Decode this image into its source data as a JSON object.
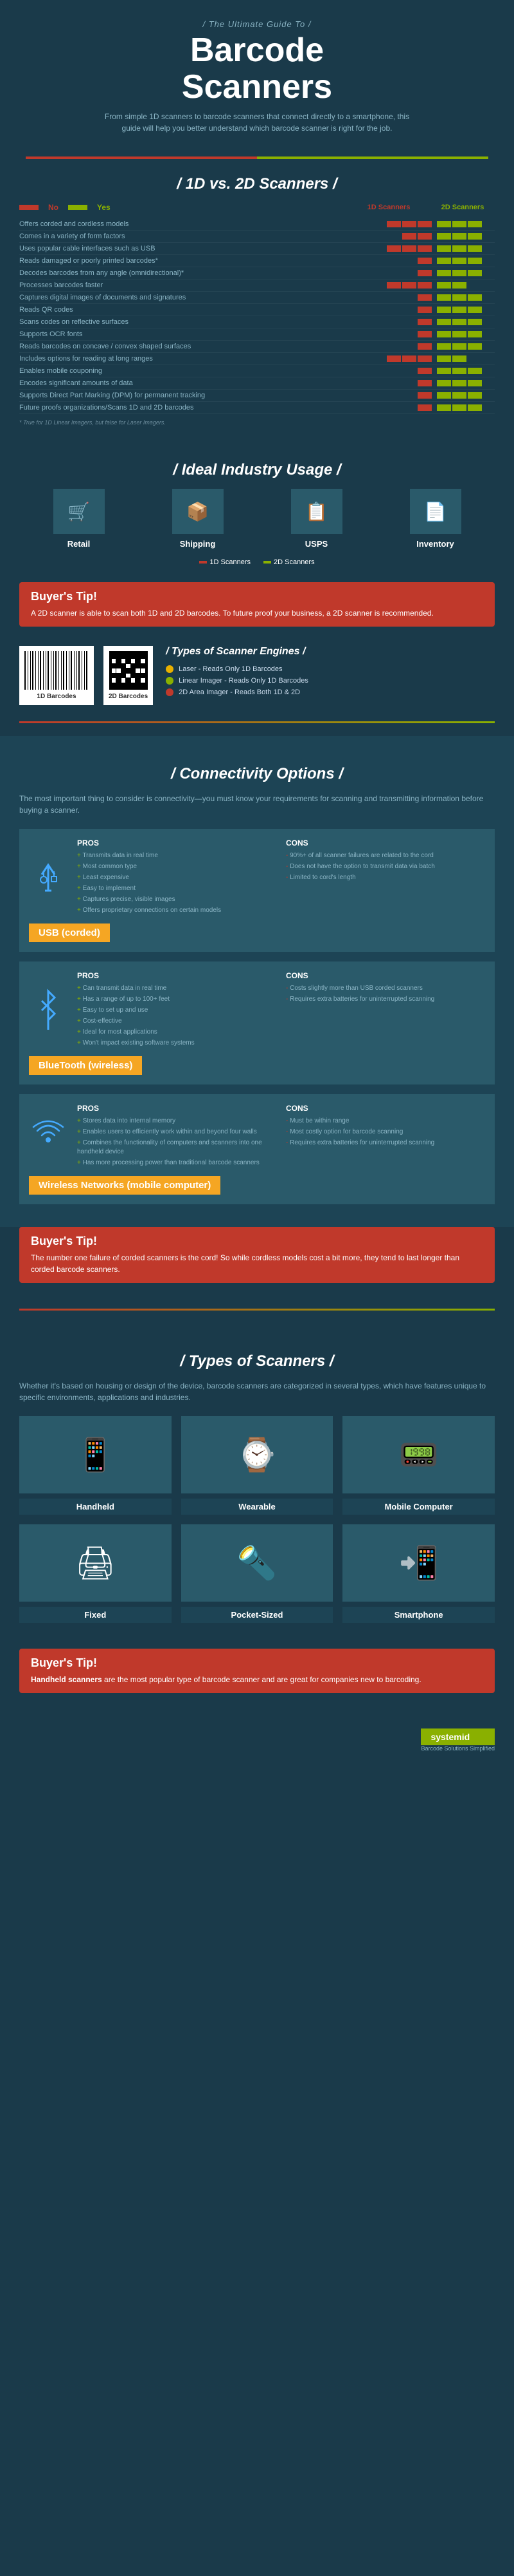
{
  "header": {
    "subtitle_top": "/ The Ultimate Guide To /",
    "title_line1": "Barcode",
    "title_line2": "Scanners",
    "description": "From simple 1D scanners to barcode scanners that connect directly to a smartphone, this guide will help you better understand which barcode scanner is right for the job."
  },
  "compare": {
    "section_title": "/ 1D vs. 2D Scanners /",
    "legend_no": "No",
    "legend_yes": "Yes",
    "col1": "1D Scanners",
    "col2": "2D Scanners",
    "rows": [
      {
        "label": "Offers corded and cordless models",
        "1d": 3,
        "2d": 3
      },
      {
        "label": "Comes in a variety of form factors",
        "1d": 2,
        "2d": 3
      },
      {
        "label": "Uses popular cable interfaces such as USB",
        "1d": 3,
        "2d": 3
      },
      {
        "label": "Reads damaged or poorly printed barcodes*",
        "1d": 1,
        "2d": 3
      },
      {
        "label": "Decodes barcodes from any angle (omnidirectional)*",
        "1d": 1,
        "2d": 3
      },
      {
        "label": "Processes barcodes faster",
        "1d": 3,
        "2d": 2
      },
      {
        "label": "Captures digital images of documents and signatures",
        "1d": 1,
        "2d": 3
      },
      {
        "label": "Reads QR codes",
        "1d": 1,
        "2d": 3
      },
      {
        "label": "Scans codes on reflective surfaces",
        "1d": 1,
        "2d": 3
      },
      {
        "label": "Supports OCR fonts",
        "1d": 1,
        "2d": 3
      },
      {
        "label": "Reads barcodes on concave / convex shaped surfaces",
        "1d": 1,
        "2d": 3
      },
      {
        "label": "Includes options for reading at long ranges",
        "1d": 3,
        "2d": 2
      },
      {
        "label": "Enables mobile couponing",
        "1d": 1,
        "2d": 3
      },
      {
        "label": "Encodes significant amounts of data",
        "1d": 1,
        "2d": 3
      },
      {
        "label": "Supports Direct Part Marking (DPM) for permanent tracking",
        "1d": 1,
        "2d": 3
      },
      {
        "label": "Future proofs organizations/Scans 1D and 2D barcodes",
        "1d": 1,
        "2d": 3
      }
    ],
    "footnote": "* True for 1D Linear Imagers, but false for Laser Imagers."
  },
  "industry": {
    "section_title": "/ Ideal Industry Usage /",
    "items": [
      {
        "name": "Retail",
        "icon": "🛒"
      },
      {
        "name": "Shipping",
        "icon": "📦"
      },
      {
        "name": "USPS",
        "icon": "📋"
      },
      {
        "name": "Inventory",
        "icon": "📄"
      }
    ],
    "legend_1d": "1D Scanners",
    "legend_2d": "2D Scanners"
  },
  "buyers_tip_1": {
    "heading": "Buyer's Tip!",
    "text": "A 2D scanner is able to scan both 1D and 2D barcodes. To future proof your business, a 2D scanner is recommended."
  },
  "engines": {
    "section_title": "/ Types of Scanner Engines /",
    "items": [
      {
        "color": "#e8b000",
        "text": "Laser - Reads Only 1D Barcodes"
      },
      {
        "color": "#8ab000",
        "text": "Linear Imager - Reads Only 1D Barcodes"
      },
      {
        "color": "#c0392b",
        "text": "2D Area Imager - Reads Both 1D & 2D"
      }
    ],
    "label_1d": "1D Barcodes",
    "label_2d": "2D Barcodes"
  },
  "connectivity": {
    "section_title": "/ Connectivity Options /",
    "description": "The most important thing to consider is connectivity—you must know your requirements for scanning and transmitting information before buying a scanner.",
    "usb": {
      "label": "USB (corded)",
      "pros_heading": "PROS",
      "cons_heading": "CONS",
      "pros": [
        "Transmits data in real time",
        "Most common type",
        "Least expensive",
        "Easy to implement",
        "Captures precise, visible images",
        "Offers proprietary connections on certain models"
      ],
      "cons": [
        "90%+ of all scanner failures are related to the cord",
        "Does not have the option to transmit data via batch",
        "Limited to cord's length"
      ]
    },
    "bluetooth": {
      "label": "BlueTooth (wireless)",
      "pros_heading": "PROS",
      "cons_heading": "CONS",
      "pros": [
        "Can transmit data in real time",
        "Has a range of up to 100+ feet",
        "Easy to set up and use",
        "Cost-effective",
        "Ideal for most applications",
        "Won't impact existing software systems"
      ],
      "cons": [
        "Costs slightly more than USB corded scanners",
        "Requires extra batteries for uninterrupted scanning"
      ]
    },
    "wireless": {
      "label": "Wireless Networks (mobile computer)",
      "pros_heading": "PROS",
      "cons_heading": "CONS",
      "pros": [
        "Stores data into internal memory",
        "Enables users to efficiently work within and beyond four walls",
        "Combines the functionality of computers and scanners into one handheld device",
        "Has more processing power than traditional barcode scanners"
      ],
      "cons": [
        "Must be within range",
        "Most costly option for barcode scanning",
        "Requires extra batteries for uninterrupted scanning"
      ]
    }
  },
  "buyers_tip_2": {
    "heading": "Buyer's Tip!",
    "text": "The number one failure of corded scanners is the cord! So while cordless models cost a bit more, they tend to last longer than corded barcode scanners."
  },
  "scanner_types": {
    "section_title": "/ Types of Scanners /",
    "description": "Whether it's based on housing or design of the device, barcode scanners are categorized in several types, which have features unique to specific environments, applications and industries.",
    "items": [
      {
        "name": "Handheld",
        "icon": "📱"
      },
      {
        "name": "Wearable",
        "icon": "⌚"
      },
      {
        "name": "Mobile Computer",
        "icon": "📟"
      },
      {
        "name": "Fixed",
        "icon": "🖨"
      },
      {
        "name": "Pocket-Sized",
        "icon": "🔦"
      },
      {
        "name": "Smartphone",
        "icon": "📲"
      }
    ]
  },
  "buyers_tip_3": {
    "heading": "Buyer's Tip!",
    "text_bold": "Handheld scanners",
    "text": " are the most popular type of barcode scanner and are great for companies new to barcoding."
  },
  "footer": {
    "logo": "systemid",
    "tagline": "Barcode Solutions Simplified"
  }
}
